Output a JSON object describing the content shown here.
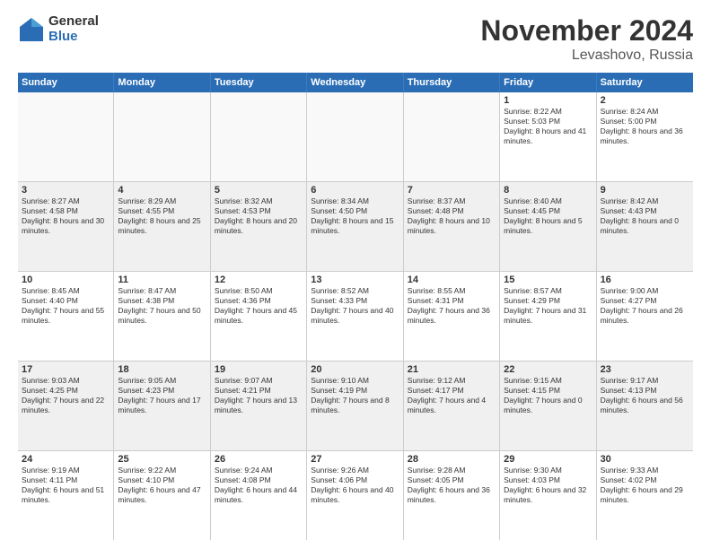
{
  "logo": {
    "general": "General",
    "blue": "Blue"
  },
  "header": {
    "month": "November 2024",
    "location": "Levashovo, Russia"
  },
  "days": [
    "Sunday",
    "Monday",
    "Tuesday",
    "Wednesday",
    "Thursday",
    "Friday",
    "Saturday"
  ],
  "rows": [
    [
      {
        "day": "",
        "empty": true
      },
      {
        "day": "",
        "empty": true
      },
      {
        "day": "",
        "empty": true
      },
      {
        "day": "",
        "empty": true
      },
      {
        "day": "",
        "empty": true
      },
      {
        "day": "1",
        "sunrise": "Sunrise: 8:22 AM",
        "sunset": "Sunset: 5:03 PM",
        "daylight": "Daylight: 8 hours and 41 minutes."
      },
      {
        "day": "2",
        "sunrise": "Sunrise: 8:24 AM",
        "sunset": "Sunset: 5:00 PM",
        "daylight": "Daylight: 8 hours and 36 minutes."
      }
    ],
    [
      {
        "day": "3",
        "sunrise": "Sunrise: 8:27 AM",
        "sunset": "Sunset: 4:58 PM",
        "daylight": "Daylight: 8 hours and 30 minutes."
      },
      {
        "day": "4",
        "sunrise": "Sunrise: 8:29 AM",
        "sunset": "Sunset: 4:55 PM",
        "daylight": "Daylight: 8 hours and 25 minutes."
      },
      {
        "day": "5",
        "sunrise": "Sunrise: 8:32 AM",
        "sunset": "Sunset: 4:53 PM",
        "daylight": "Daylight: 8 hours and 20 minutes."
      },
      {
        "day": "6",
        "sunrise": "Sunrise: 8:34 AM",
        "sunset": "Sunset: 4:50 PM",
        "daylight": "Daylight: 8 hours and 15 minutes."
      },
      {
        "day": "7",
        "sunrise": "Sunrise: 8:37 AM",
        "sunset": "Sunset: 4:48 PM",
        "daylight": "Daylight: 8 hours and 10 minutes."
      },
      {
        "day": "8",
        "sunrise": "Sunrise: 8:40 AM",
        "sunset": "Sunset: 4:45 PM",
        "daylight": "Daylight: 8 hours and 5 minutes."
      },
      {
        "day": "9",
        "sunrise": "Sunrise: 8:42 AM",
        "sunset": "Sunset: 4:43 PM",
        "daylight": "Daylight: 8 hours and 0 minutes."
      }
    ],
    [
      {
        "day": "10",
        "sunrise": "Sunrise: 8:45 AM",
        "sunset": "Sunset: 4:40 PM",
        "daylight": "Daylight: 7 hours and 55 minutes."
      },
      {
        "day": "11",
        "sunrise": "Sunrise: 8:47 AM",
        "sunset": "Sunset: 4:38 PM",
        "daylight": "Daylight: 7 hours and 50 minutes."
      },
      {
        "day": "12",
        "sunrise": "Sunrise: 8:50 AM",
        "sunset": "Sunset: 4:36 PM",
        "daylight": "Daylight: 7 hours and 45 minutes."
      },
      {
        "day": "13",
        "sunrise": "Sunrise: 8:52 AM",
        "sunset": "Sunset: 4:33 PM",
        "daylight": "Daylight: 7 hours and 40 minutes."
      },
      {
        "day": "14",
        "sunrise": "Sunrise: 8:55 AM",
        "sunset": "Sunset: 4:31 PM",
        "daylight": "Daylight: 7 hours and 36 minutes."
      },
      {
        "day": "15",
        "sunrise": "Sunrise: 8:57 AM",
        "sunset": "Sunset: 4:29 PM",
        "daylight": "Daylight: 7 hours and 31 minutes."
      },
      {
        "day": "16",
        "sunrise": "Sunrise: 9:00 AM",
        "sunset": "Sunset: 4:27 PM",
        "daylight": "Daylight: 7 hours and 26 minutes."
      }
    ],
    [
      {
        "day": "17",
        "sunrise": "Sunrise: 9:03 AM",
        "sunset": "Sunset: 4:25 PM",
        "daylight": "Daylight: 7 hours and 22 minutes."
      },
      {
        "day": "18",
        "sunrise": "Sunrise: 9:05 AM",
        "sunset": "Sunset: 4:23 PM",
        "daylight": "Daylight: 7 hours and 17 minutes."
      },
      {
        "day": "19",
        "sunrise": "Sunrise: 9:07 AM",
        "sunset": "Sunset: 4:21 PM",
        "daylight": "Daylight: 7 hours and 13 minutes."
      },
      {
        "day": "20",
        "sunrise": "Sunrise: 9:10 AM",
        "sunset": "Sunset: 4:19 PM",
        "daylight": "Daylight: 7 hours and 8 minutes."
      },
      {
        "day": "21",
        "sunrise": "Sunrise: 9:12 AM",
        "sunset": "Sunset: 4:17 PM",
        "daylight": "Daylight: 7 hours and 4 minutes."
      },
      {
        "day": "22",
        "sunrise": "Sunrise: 9:15 AM",
        "sunset": "Sunset: 4:15 PM",
        "daylight": "Daylight: 7 hours and 0 minutes."
      },
      {
        "day": "23",
        "sunrise": "Sunrise: 9:17 AM",
        "sunset": "Sunset: 4:13 PM",
        "daylight": "Daylight: 6 hours and 56 minutes."
      }
    ],
    [
      {
        "day": "24",
        "sunrise": "Sunrise: 9:19 AM",
        "sunset": "Sunset: 4:11 PM",
        "daylight": "Daylight: 6 hours and 51 minutes."
      },
      {
        "day": "25",
        "sunrise": "Sunrise: 9:22 AM",
        "sunset": "Sunset: 4:10 PM",
        "daylight": "Daylight: 6 hours and 47 minutes."
      },
      {
        "day": "26",
        "sunrise": "Sunrise: 9:24 AM",
        "sunset": "Sunset: 4:08 PM",
        "daylight": "Daylight: 6 hours and 44 minutes."
      },
      {
        "day": "27",
        "sunrise": "Sunrise: 9:26 AM",
        "sunset": "Sunset: 4:06 PM",
        "daylight": "Daylight: 6 hours and 40 minutes."
      },
      {
        "day": "28",
        "sunrise": "Sunrise: 9:28 AM",
        "sunset": "Sunset: 4:05 PM",
        "daylight": "Daylight: 6 hours and 36 minutes."
      },
      {
        "day": "29",
        "sunrise": "Sunrise: 9:30 AM",
        "sunset": "Sunset: 4:03 PM",
        "daylight": "Daylight: 6 hours and 32 minutes."
      },
      {
        "day": "30",
        "sunrise": "Sunrise: 9:33 AM",
        "sunset": "Sunset: 4:02 PM",
        "daylight": "Daylight: 6 hours and 29 minutes."
      }
    ]
  ]
}
